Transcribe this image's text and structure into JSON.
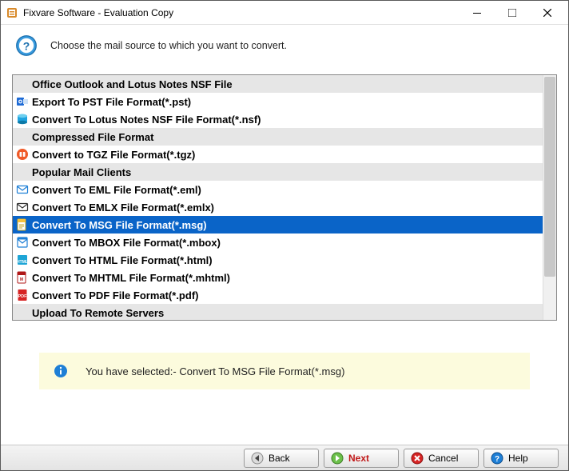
{
  "window": {
    "title": "Fixvare Software - Evaluation Copy"
  },
  "header": {
    "prompt": "Choose the mail source to which you want to convert."
  },
  "list": [
    {
      "type": "header",
      "label": "Office Outlook and Lotus Notes NSF File"
    },
    {
      "type": "item",
      "icon": "outlook",
      "label": "Export To PST File Format(*.pst)"
    },
    {
      "type": "item",
      "icon": "nsf",
      "label": "Convert To Lotus Notes NSF File Format(*.nsf)"
    },
    {
      "type": "header",
      "label": "Compressed File Format"
    },
    {
      "type": "item",
      "icon": "tgz",
      "label": "Convert to TGZ File Format(*.tgz)"
    },
    {
      "type": "header",
      "label": "Popular Mail Clients"
    },
    {
      "type": "item",
      "icon": "eml",
      "label": "Convert To EML File Format(*.eml)"
    },
    {
      "type": "item",
      "icon": "emlx",
      "label": "Convert To EMLX File Format(*.emlx)"
    },
    {
      "type": "item",
      "icon": "msg",
      "label": "Convert To MSG File Format(*.msg)",
      "selected": true
    },
    {
      "type": "item",
      "icon": "mbox",
      "label": "Convert To MBOX File Format(*.mbox)"
    },
    {
      "type": "item",
      "icon": "html",
      "label": "Convert To HTML File Format(*.html)"
    },
    {
      "type": "item",
      "icon": "mhtml",
      "label": "Convert To MHTML File Format(*.mhtml)"
    },
    {
      "type": "item",
      "icon": "pdf",
      "label": "Convert To PDF File Format(*.pdf)"
    },
    {
      "type": "header",
      "label": "Upload To Remote Servers"
    }
  ],
  "info": {
    "text": "You have selected:- Convert To MSG File Format(*.msg)"
  },
  "footer": {
    "back": "Back",
    "next": "Next",
    "cancel": "Cancel",
    "help": "Help"
  },
  "icon_colors": {
    "outlook": "#1e6bd6",
    "nsf": "#1fa3e0",
    "tgz": "#f05a28",
    "eml": "#1e7fd6",
    "emlx": "#333333",
    "msg": "#f7c23c",
    "mbox": "#1e7fd6",
    "html": "#1ea5d6",
    "mhtml": "#b01818",
    "pdf": "#d62424"
  }
}
